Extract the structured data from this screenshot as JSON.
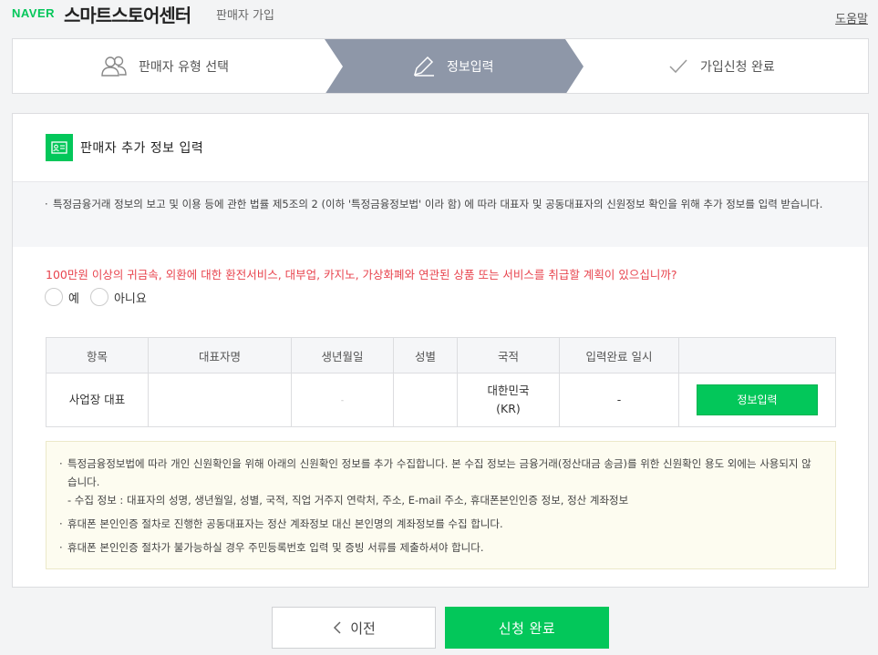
{
  "header": {
    "logo": "NAVER",
    "brand": "스마트스토어센터",
    "subtitle": "판매자 가입",
    "help_link": "도움말"
  },
  "steps": [
    {
      "label": "판매자 유형 선택",
      "icon": "users-icon",
      "active": false
    },
    {
      "label": "정보입력",
      "icon": "pencil-icon",
      "active": true
    },
    {
      "label": "가입신청 완료",
      "icon": "check-icon",
      "active": false
    }
  ],
  "colors": {
    "accent": "#03c75a",
    "active_step": "#8e97a8",
    "question_red": "#e8444e"
  },
  "section": {
    "title": "판매자 추가 정보 입력",
    "icon": "id-card-icon",
    "notice": "특정금융거래 정보의 보고 및 이용 등에 관한 법률 제5조의 2 (이하 '특정금융정보법' 이라 함) 에 따라 대표자 및 공동대표자의 신원정보 확인을 위해 추가 정보를 입력 받습니다."
  },
  "question": {
    "text": "100만원 이상의 귀금속, 외환에 대한 환전서비스, 대부업, 카지노, 가상화폐와 연관된 상품 또는 서비스를 취급할 계획이 있으십니까?",
    "options": [
      "예",
      "아니요"
    ]
  },
  "table": {
    "headers": [
      "항목",
      "대표자명",
      "생년월일",
      "성별",
      "국적",
      "입력완료 일시",
      ""
    ],
    "row": {
      "item": "사업장 대표",
      "name": "",
      "birth": "-",
      "gender": "",
      "nationality_line1": "대한민국",
      "nationality_line2": "(KR)",
      "completed_at": "-",
      "button": "정보입력"
    }
  },
  "notice_box": {
    "item1": "특정금융정보법에 따라 개인 신원확인을 위해 아래의 신원확인 정보를 추가 수집합니다. 본 수집 정보는 금융거래(정산대금 송금)를 위한 신원확인 용도 외에는 사용되지 않습니다.",
    "item1_sub": "- 수집 정보 : 대표자의 성명, 생년월일, 성별, 국적, 직업 거주지 연락처, 주소, E-mail 주소, 휴대폰본인인증 정보, 정산 계좌정보",
    "item2": "휴대폰 본인인증 절차로 진행한 공동대표자는 정산 계좌정보 대신 본인명의 계좌정보를 수집 합니다.",
    "item3": "휴대폰 본인인증 절차가 불가능하실 경우 주민등록번호 입력 및 증빙 서류를 제출하셔야 합니다."
  },
  "footer": {
    "prev_label": "이전",
    "submit_label": "신청 완료"
  }
}
